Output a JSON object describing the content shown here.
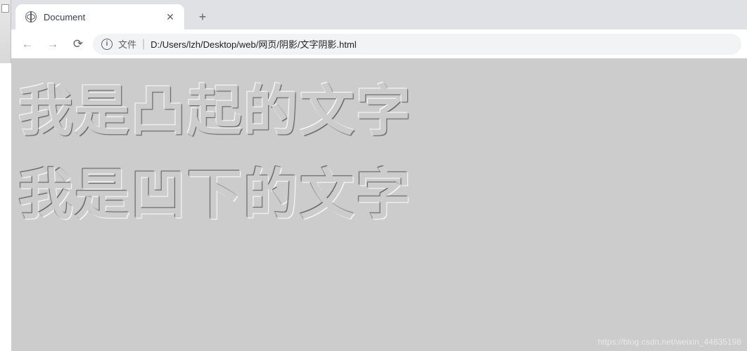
{
  "tab": {
    "title": "Document",
    "close_glyph": "✕",
    "newtab_glyph": "+"
  },
  "toolbar": {
    "back_glyph": "←",
    "forward_glyph": "→",
    "reload_glyph": "⟳"
  },
  "addressbar": {
    "info_glyph": "i",
    "prefix": "文件",
    "separator": "|",
    "url": "D:/Users/lzh/Desktop/web/网页/阴影/文字阴影.html"
  },
  "content": {
    "raised_text": "我是凸起的文字",
    "sunken_text": "我是凹下的文字"
  },
  "watermark": "https://blog.csdn.net/weixin_44635198"
}
